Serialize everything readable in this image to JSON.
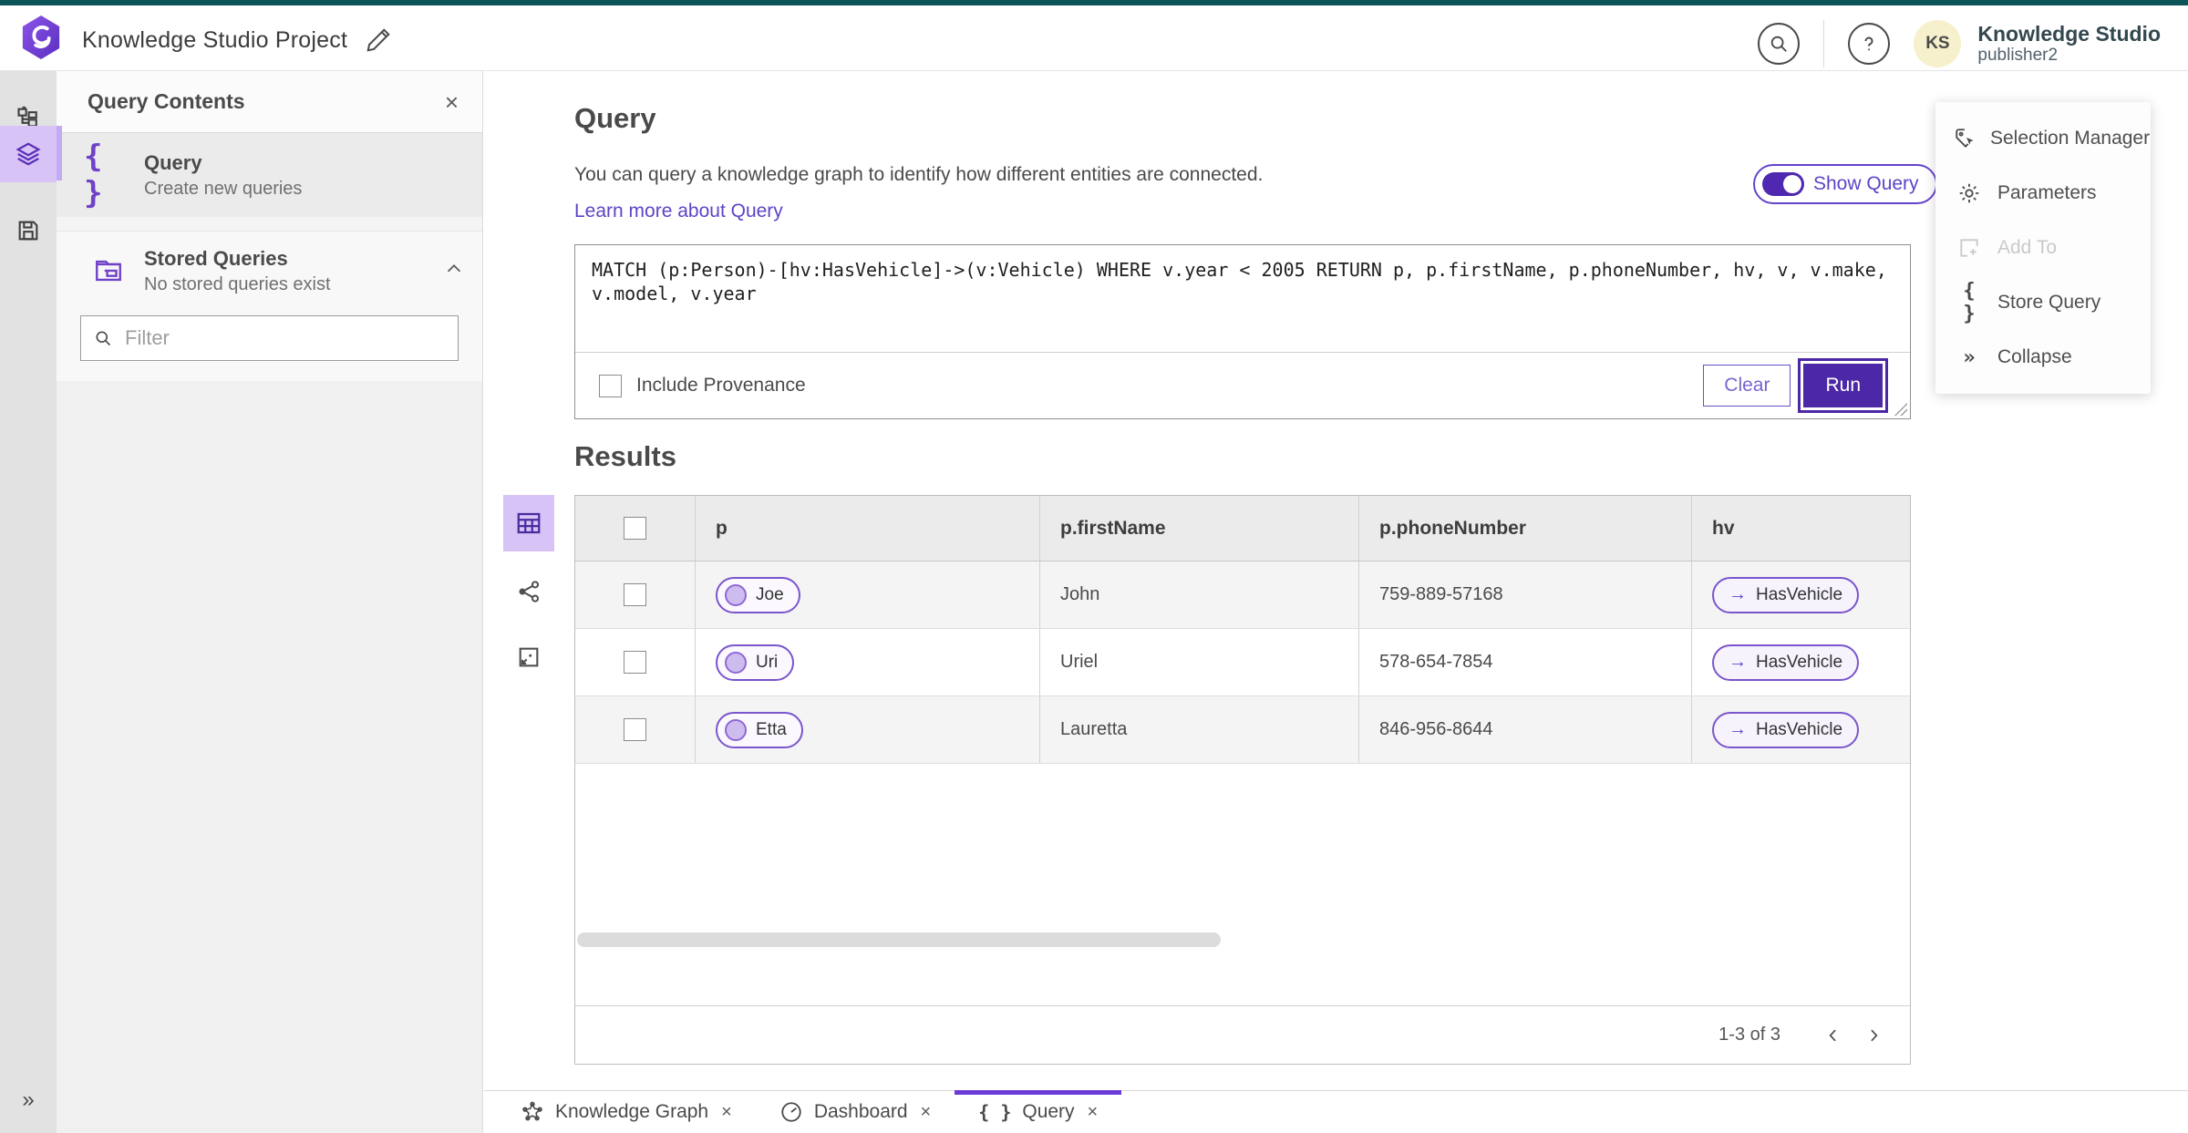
{
  "header": {
    "title": "Knowledge Studio Project",
    "product": "Knowledge Studio",
    "username": "publisher2",
    "avatar_initials": "KS"
  },
  "panel": {
    "title": "Query Contents",
    "query_item": {
      "title": "Query",
      "subtitle": "Create new queries"
    },
    "stored_item": {
      "title": "Stored Queries",
      "subtitle": "No stored queries exist"
    },
    "filter_placeholder": "Filter"
  },
  "query": {
    "heading": "Query",
    "description": "You can query a knowledge graph to identify how different entities are connected.",
    "learn_more": "Learn more about Query",
    "show_query_label": "Show Query",
    "query_text": "MATCH (p:Person)-[hv:HasVehicle]->(v:Vehicle) WHERE v.year < 2005 RETURN p, p.firstName, p.phoneNumber, hv, v, v.make, v.model, v.year",
    "include_provenance_label": "Include Provenance",
    "clear_label": "Clear",
    "run_label": "Run"
  },
  "results": {
    "heading": "Results",
    "columns": [
      "p",
      "p.firstName",
      "p.phoneNumber",
      "hv"
    ],
    "rows": [
      {
        "p": "Joe",
        "firstName": "John",
        "phone": "759-889-57168",
        "hv": "HasVehicle"
      },
      {
        "p": "Uri",
        "firstName": "Uriel",
        "phone": "578-654-7854",
        "hv": "HasVehicle"
      },
      {
        "p": "Etta",
        "firstName": "Lauretta",
        "phone": "846-956-8644",
        "hv": "HasVehicle"
      }
    ],
    "pagination": "1-3 of 3"
  },
  "tools": {
    "items": [
      {
        "label": "Selection Manager"
      },
      {
        "label": "Parameters"
      },
      {
        "label": "Add To"
      },
      {
        "label": "Store Query"
      },
      {
        "label": "Collapse"
      }
    ]
  },
  "tabs": [
    {
      "label": "Knowledge Graph"
    },
    {
      "label": "Dashboard"
    },
    {
      "label": "Query"
    }
  ],
  "icons": {
    "braces": "{ }",
    "collapse_chevrons": "»",
    "expand_chevrons": "»",
    "close": "×",
    "arrow_right": "→"
  },
  "colors": {
    "top_strip": "#0d545a",
    "accent_purple": "#6a43c8",
    "deep_purple": "#4d28a6",
    "selected_tile": "#d7c3f6",
    "pill_border": "#7a55cc"
  }
}
